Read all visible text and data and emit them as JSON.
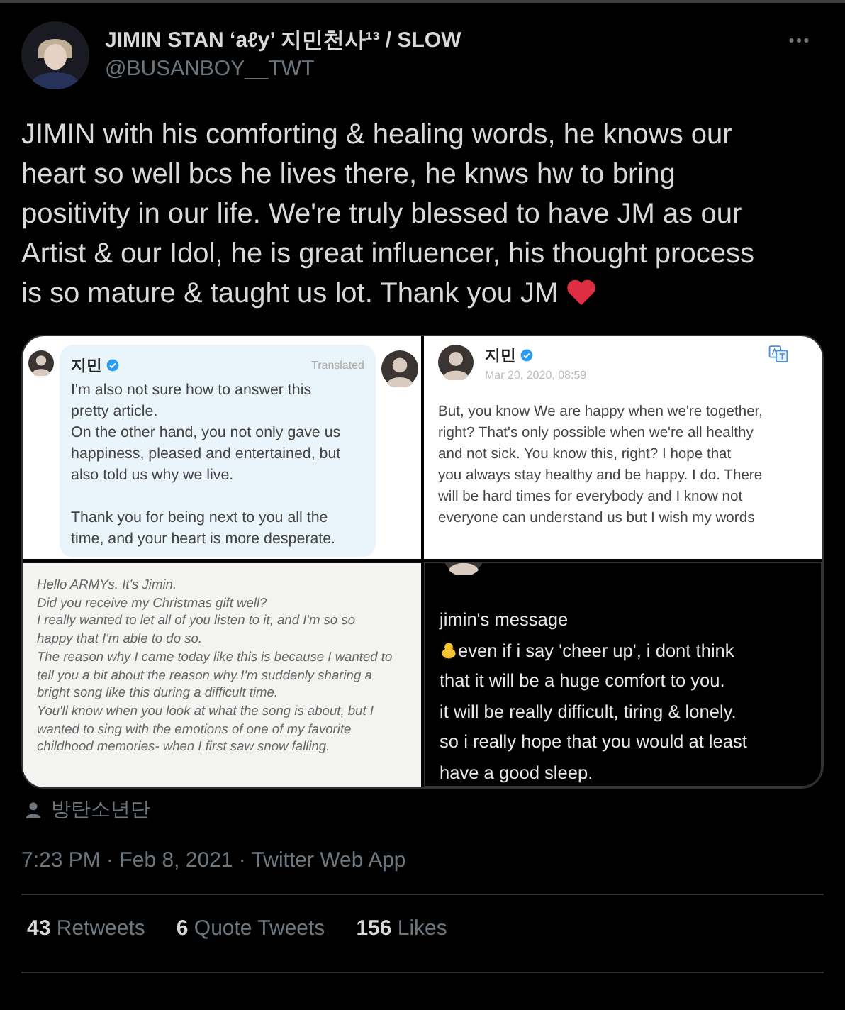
{
  "author": {
    "name": "JIMIN STAN ‘aℓy’ 지민천사¹³ / SLOW",
    "handle": "@BUSANBOY__TWT"
  },
  "text": "JIMIN with his comforting & healing words, he knows our heart so well bcs he lives there, he knws hw to bring positivity in our life. We're truly blessed to have JM as our Artist & our Idol, he is great influencer, his thought process is so mature & taught us lot. Thank you JM",
  "media": [
    {
      "kind": "translated_reply",
      "name": "지민",
      "verified": true,
      "note": "Translated",
      "paragraphs": [
        [
          "I'm also not sure how to answer this",
          "pretty article.",
          "On the other hand, you not only gave us",
          "happiness, pleased and entertained, but",
          "also told us why we live."
        ],
        [
          "Thank you for being next to you all the",
          "time, and your heart is more desperate."
        ]
      ]
    },
    {
      "kind": "profile_post",
      "name": "지민",
      "verified": true,
      "date": "Mar 20, 2020, 08:59",
      "paragraphs": [
        [
          "But, you know We are happy when we're together,",
          "right?  That's only possible when we're all healthy",
          "and not sick.  You know this, right?  I hope that",
          "you always stay healthy and be happy. I do.  There",
          "will be hard times for everybody  and I know not",
          "everyone can understand us  but I wish my words"
        ]
      ]
    },
    {
      "kind": "letter",
      "paragraphs": [
        [
          "Hello ARMYs. It's Jimin.",
          "Did you receive my Christmas gift well?",
          "I really wanted to let all of you listen to it, and I'm so so",
          "happy that I'm able to do so.",
          "The reason why I came today like this is because I wanted to",
          "tell you a bit about the reason why I'm suddenly sharing a",
          "bright song like this during a difficult time.",
          "You'll know when you look at what the song is about, but I",
          "wanted to sing with the emotions of one of my favorite",
          "childhood memories- when I first saw snow falling."
        ]
      ]
    },
    {
      "kind": "dark_tweet",
      "title": "jimin's message",
      "paragraphs": [
        [
          "even if i say 'cheer up', i dont think",
          "that it will be a huge comfort to you.",
          "it will be really difficult, tiring & lonely.",
          "so i really hope that you would at least",
          "have a good sleep."
        ]
      ]
    }
  ],
  "tag": "방탄소년단",
  "timestamp": "7:23 PM · Feb 8, 2021 · Twitter Web App",
  "stats": [
    "**43** Retweets",
    "**6** Quote Tweets",
    "**156** Likes"
  ]
}
